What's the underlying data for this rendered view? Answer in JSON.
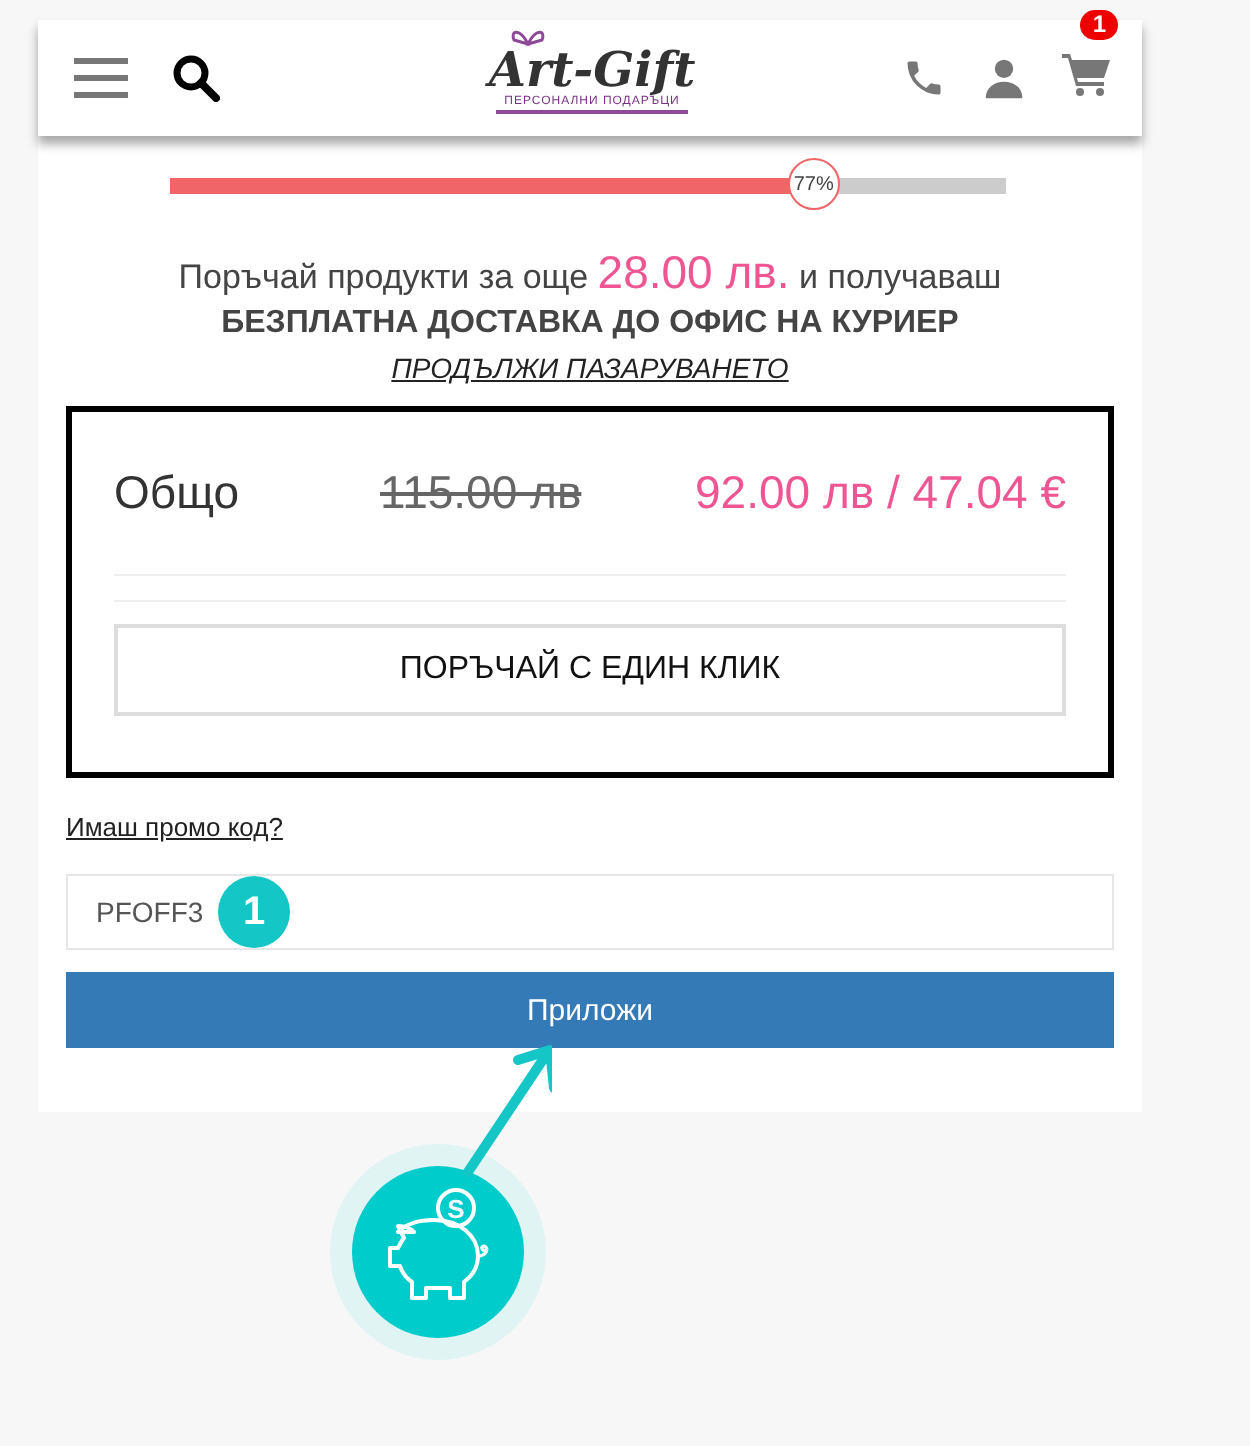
{
  "header": {
    "logo": {
      "name": "Art-Gift",
      "tagline": "ПЕРСОНАЛНИ ПОДАРЪЦИ"
    },
    "cart_count": "1"
  },
  "free_shipping": {
    "level": 0.77,
    "percent": "77%",
    "lead": "Поръчай продукти за още",
    "amount": "28.00 лв.",
    "tail": "и получаваш",
    "headline": "БЕЗПЛАТНА ДОСТАВКА ДО ОФИС НА КУРИЕР",
    "link": "ПРОДЪЛЖИ ПАЗАРУВАНЕТО"
  },
  "total": {
    "label": "Общо",
    "old_price": "115.00 лв",
    "price": "92.00 лв / 47.04 €",
    "button": "ПОРЪЧАЙ С ЕДИН КЛИК"
  },
  "promo": {
    "link": "Имаш промо код?",
    "value": "PFOFF3",
    "button": "Приложи"
  },
  "annotation": {
    "step": "1",
    "coin_symbol": "S"
  }
}
